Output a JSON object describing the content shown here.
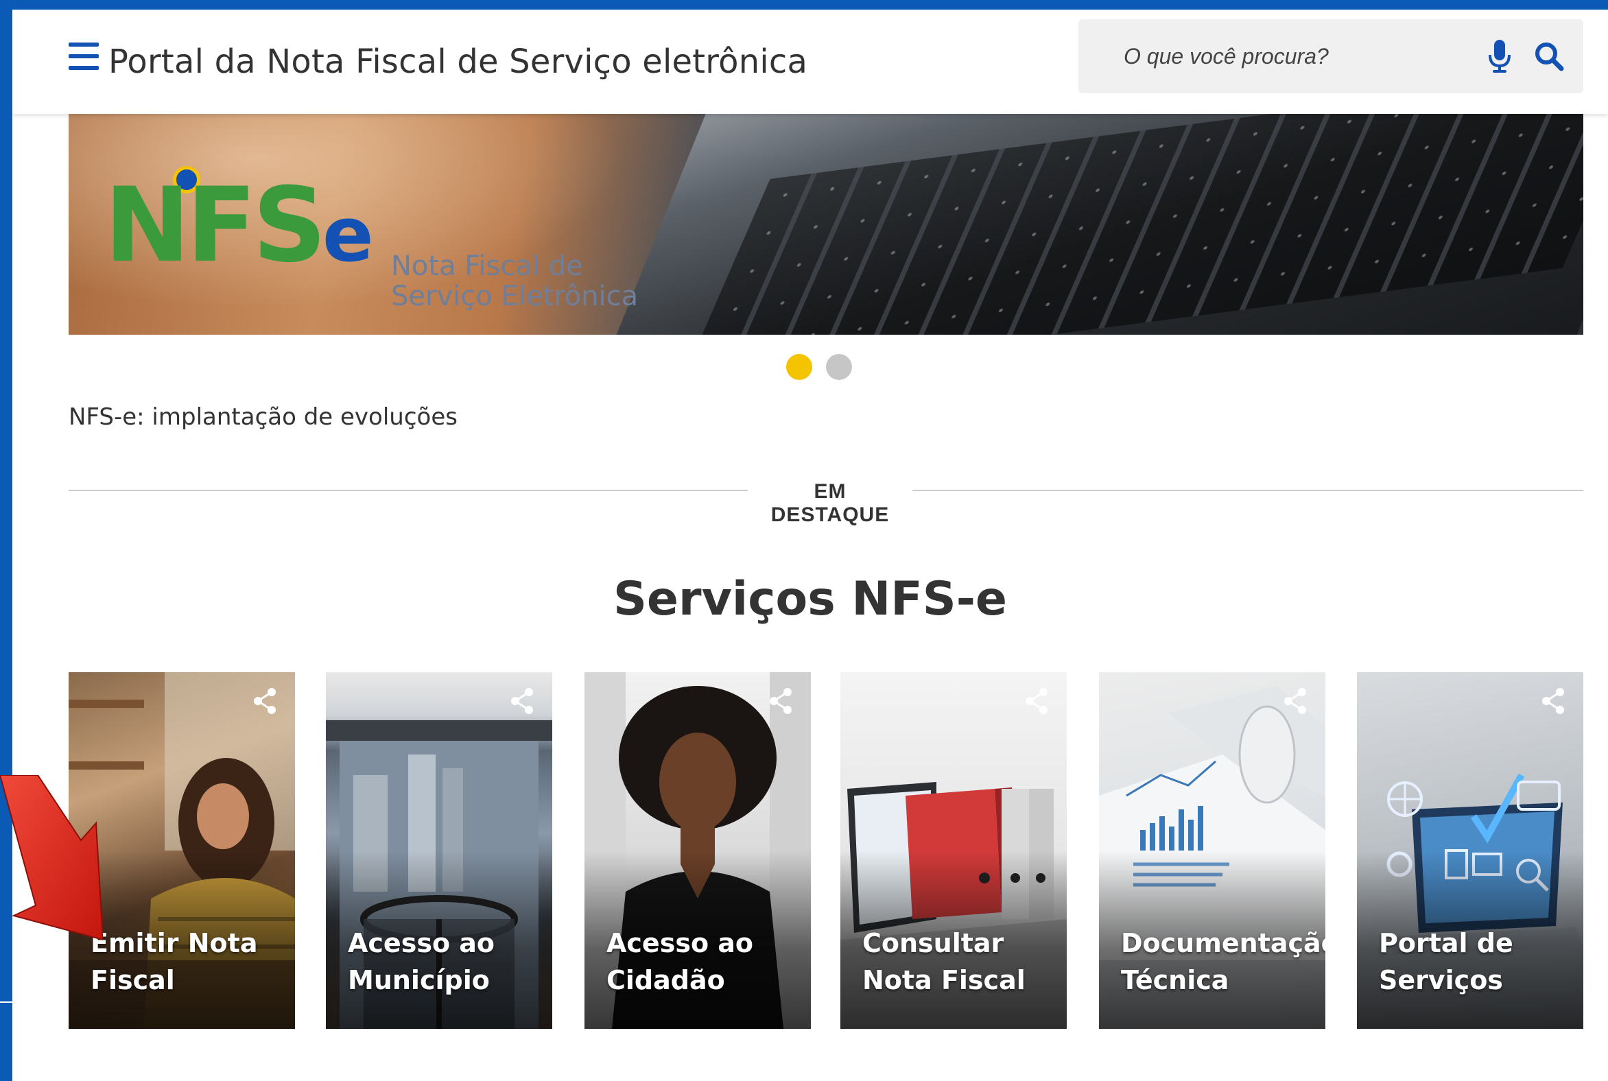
{
  "header": {
    "title": "Portal da Nota Fiscal de Serviço eletrônica",
    "search_placeholder": "O que você procura?"
  },
  "banner": {
    "logo_text": "NFS",
    "logo_suffix": "e",
    "tagline_line1": "Nota Fiscal de",
    "tagline_line2": "Serviço Eletrônica",
    "caption": "NFS-e: implantação de evoluções",
    "carousel": {
      "count": 2,
      "active": 1
    }
  },
  "featured": {
    "label": "EM DESTAQUE",
    "title": "Serviços NFS-e"
  },
  "cards": [
    {
      "line1": "Emitir Nota",
      "line2": "Fiscal"
    },
    {
      "line1": "Acesso ao",
      "line2": "Município"
    },
    {
      "line1": "Acesso ao",
      "line2": "Cidadão"
    },
    {
      "line1": "Consultar",
      "line2": "Nota Fiscal"
    },
    {
      "line1": "Documentação",
      "line2": "Técnica"
    },
    {
      "line1": "Portal de",
      "line2": "Serviços"
    }
  ],
  "icons": {
    "menu": "hamburger-menu-icon",
    "mic": "microphone-icon",
    "search": "search-icon",
    "share": "share-icon",
    "annotation": "red-arrow"
  },
  "colors": {
    "primary": "#1351b4",
    "accent_yellow": "#f5c400",
    "logo_green": "#3a9a3c",
    "annotation_red": "#e0231c",
    "frame_blue": "#0b5ab5"
  }
}
